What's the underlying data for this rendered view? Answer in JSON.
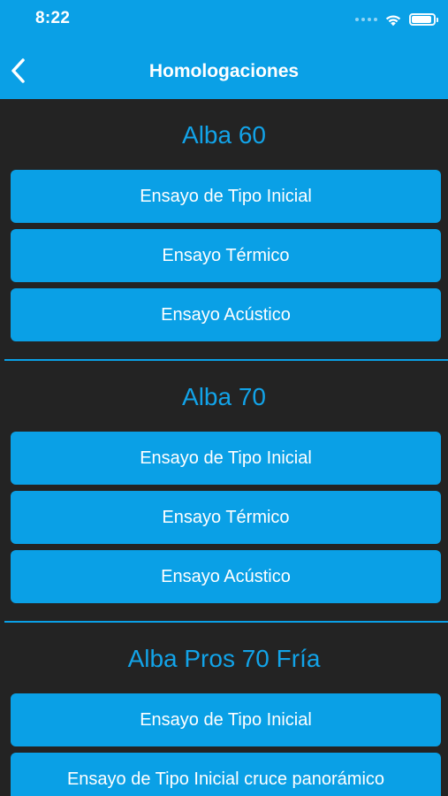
{
  "status_bar": {
    "time": "8:22",
    "icons": [
      "signal-dots-icon",
      "wifi-icon",
      "battery-icon"
    ]
  },
  "nav": {
    "back_icon": "chevron-left-icon",
    "title": "Homologaciones"
  },
  "colors": {
    "accent": "#0aa0e6",
    "background": "#232323",
    "section_title": "#12a3e8"
  },
  "sections": [
    {
      "title": "Alba 60",
      "buttons": [
        "Ensayo de Tipo Inicial",
        "Ensayo Térmico",
        "Ensayo Acústico"
      ]
    },
    {
      "title": "Alba 70",
      "buttons": [
        "Ensayo de Tipo Inicial",
        "Ensayo Térmico",
        "Ensayo Acústico"
      ]
    },
    {
      "title": "Alba Pros 70 Fría",
      "buttons": [
        "Ensayo de Tipo Inicial",
        "Ensayo de Tipo Inicial cruce panorámico"
      ]
    }
  ]
}
